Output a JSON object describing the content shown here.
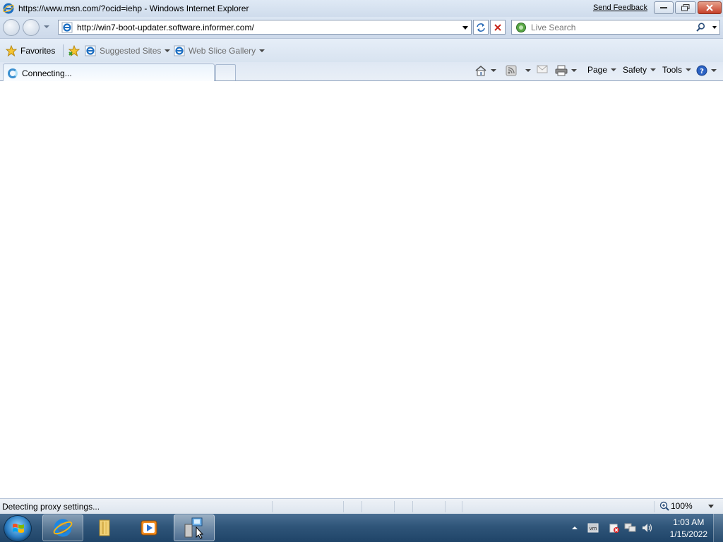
{
  "window": {
    "title": "https://www.msn.com/?ocid=iehp - Windows Internet Explorer",
    "feedback_link": "Send Feedback"
  },
  "address_bar": {
    "url": "http://win7-boot-updater.software.informer.com/"
  },
  "search": {
    "placeholder": "Live Search"
  },
  "favorites_bar": {
    "favorites_label": "Favorites",
    "suggested_sites_label": "Suggested Sites",
    "web_slice_gallery_label": "Web Slice Gallery"
  },
  "tabs": [
    {
      "label": "Connecting...",
      "state": "loading"
    }
  ],
  "command_bar": {
    "page_label": "Page",
    "safety_label": "Safety",
    "tools_label": "Tools"
  },
  "status_bar": {
    "text": "Detecting proxy settings...",
    "zoom": "100%"
  },
  "taskbar": {
    "time": "1:03 AM",
    "date": "1/15/2022"
  },
  "colors": {
    "accent": "#3b90d0",
    "taskbar": "#2f5579",
    "stop": "#c8281c"
  }
}
